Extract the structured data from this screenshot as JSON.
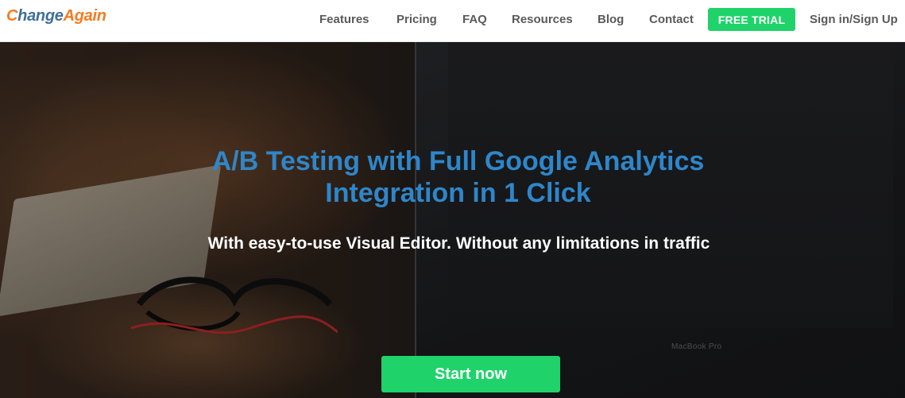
{
  "logo": {
    "part1": "C",
    "part2": "hange",
    "part3": "Again",
    "icon": "refresh-arrow-icon",
    "colors": {
      "orange": "#f47b20",
      "blue": "#3f6f9a"
    }
  },
  "nav": {
    "items": [
      {
        "label": "Features"
      },
      {
        "label": "Pricing"
      },
      {
        "label": "FAQ"
      },
      {
        "label": "Resources"
      },
      {
        "label": "Blog"
      },
      {
        "label": "Contact"
      }
    ],
    "cta_label": "FREE TRIAL",
    "signin_label": "Sign in/Sign Up"
  },
  "hero": {
    "headline_line1": "A/B Testing with Full Google Analytics",
    "headline_line2": "Integration in 1 Click",
    "subheadline": "With easy-to-use Visual Editor. Without any limitations in traffic",
    "cta_label": "Start now",
    "photo_caption": "MacBook Pro"
  },
  "colors": {
    "accent_green": "#1fd36a",
    "headline_blue": "#2f86c9",
    "nav_text": "#5a5a5a"
  }
}
